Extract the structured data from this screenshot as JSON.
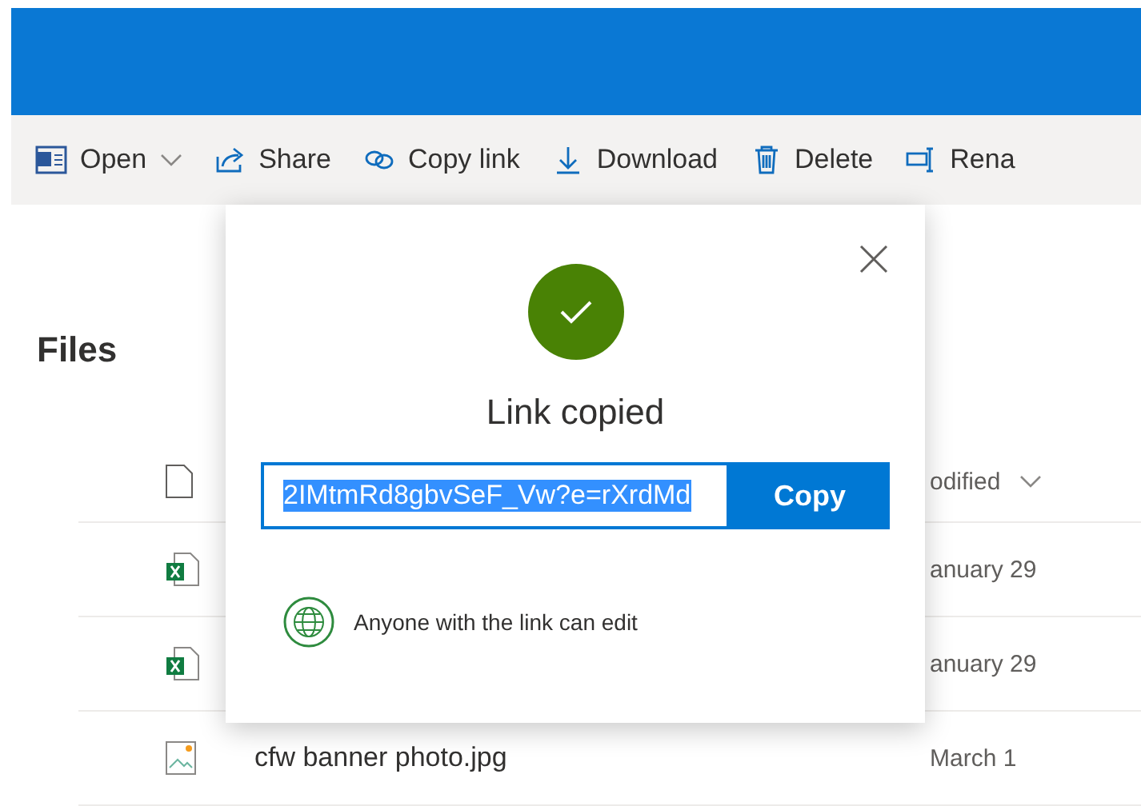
{
  "toolbar": [
    {
      "kind": "word",
      "label": "Open",
      "dropdown": true
    },
    {
      "kind": "share",
      "label": "Share",
      "dropdown": false
    },
    {
      "kind": "link",
      "label": "Copy link",
      "dropdown": false
    },
    {
      "kind": "download",
      "label": "Download",
      "dropdown": false
    },
    {
      "kind": "delete",
      "label": "Delete",
      "dropdown": false
    },
    {
      "kind": "rename",
      "label": "Rena",
      "dropdown": false
    }
  ],
  "page_title": "Files",
  "table": {
    "header": {
      "kind": "file",
      "modified": "odified",
      "sort_dropdown": true
    },
    "rows": [
      {
        "kind": "excel",
        "modified": "anuary 29"
      },
      {
        "kind": "excel",
        "modified": "anuary 29"
      },
      {
        "kind": "image",
        "name": "cfw banner photo.jpg",
        "modified": "March 1"
      }
    ]
  },
  "dialog": {
    "title": "Link copied",
    "link": {
      "value": "2IMtmRd8gbvSeF_Vw?e=rXrdMd",
      "selected": true
    },
    "copy_button": "Copy",
    "permission": "Anyone with the link can edit"
  }
}
